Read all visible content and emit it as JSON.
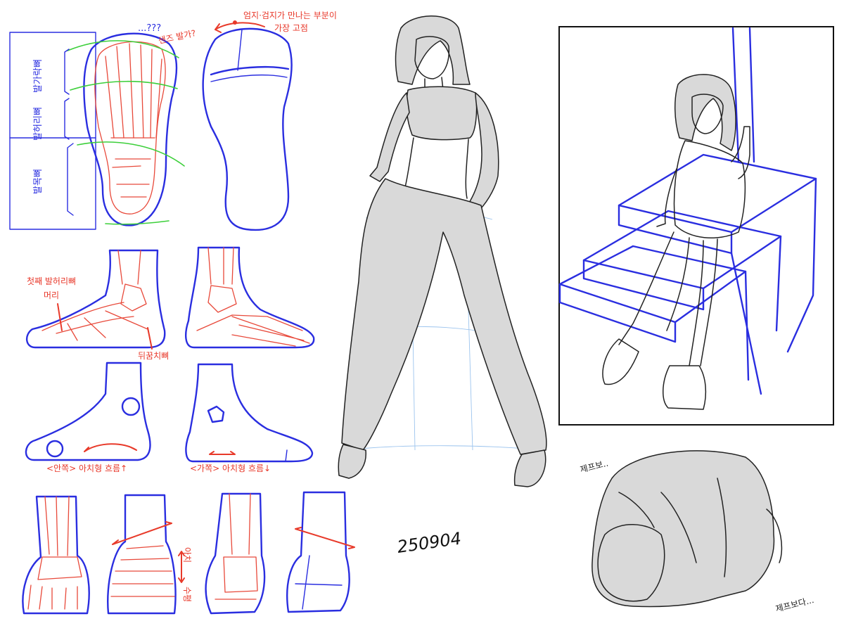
{
  "foot_study": {
    "top_labels": {
      "question": "...???",
      "sand": "샌즈 발가?",
      "weight_line1": "엄지·검지가 만나는 부분이",
      "weight_line2": "가장 고점"
    },
    "bone_labels": {
      "toes": "발가락뼈",
      "midfoot": "발허리뼈",
      "tarsal": "발목뼈"
    },
    "side_labels": {
      "first_meta_line1": "첫째 발허리뼈",
      "first_meta_line2": "머리",
      "heel": "뒤꿈치뼈"
    },
    "arch_labels": {
      "inner": "<안쪽> 아치형 흐름↑",
      "outer": "<가쪽> 아치형 흐름↓"
    },
    "front_labels": {
      "arch": "아치",
      "flat": "수평"
    }
  },
  "date_stamp": "250904",
  "crouch_labels": {
    "top": "제프보..",
    "bottom": "제프보다..."
  },
  "colors": {
    "construction_blue": "#2a2ee0",
    "anatomy_red": "#e8493a",
    "guide_green": "#3ccf3a",
    "ink": "#222222",
    "tone_gray": "#d9d9d9"
  }
}
